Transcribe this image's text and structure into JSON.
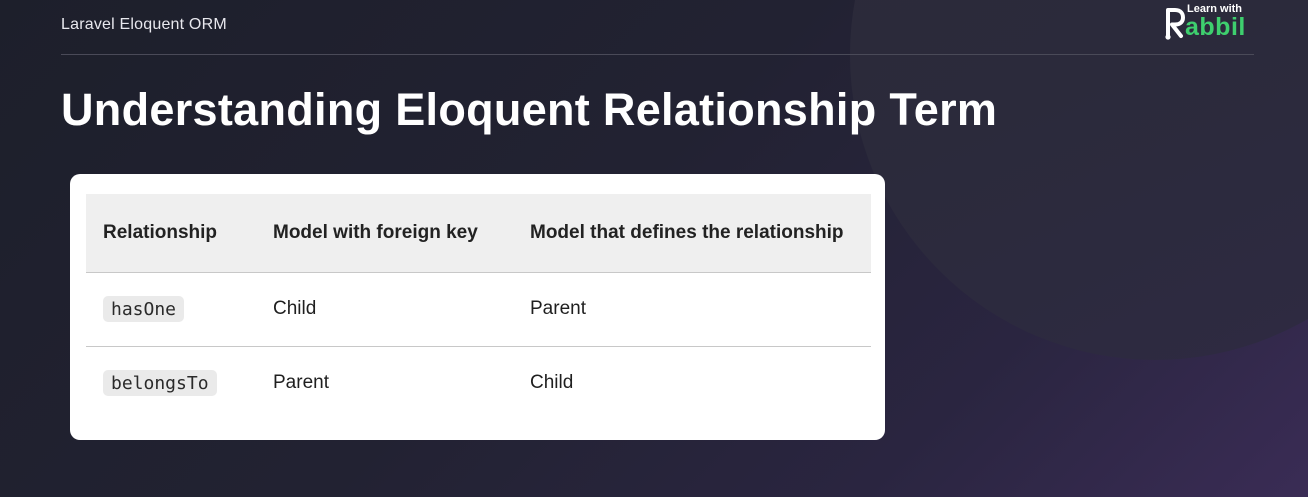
{
  "header": {
    "course_title": "Laravel Eloquent ORM"
  },
  "logo": {
    "top_text": "Learn with",
    "brand_text": "abbil",
    "brand_color": "#3ecf6e"
  },
  "slide": {
    "title": "Understanding Eloquent Relationship Term"
  },
  "table": {
    "columns": [
      "Relationship",
      "Model with foreign key",
      "Model that defines the relationship"
    ],
    "rows": [
      {
        "relationship": "hasOne",
        "foreign_key_model": "Child",
        "defining_model": "Parent"
      },
      {
        "relationship": "belongsTo",
        "foreign_key_model": "Parent",
        "defining_model": "Child"
      }
    ]
  }
}
